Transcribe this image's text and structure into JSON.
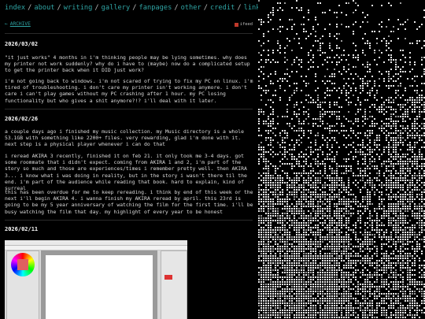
{
  "nav": {
    "items": [
      "index",
      "about",
      "writing",
      "gallery",
      "fanpages",
      "other",
      "credit",
      "links"
    ],
    "separator": "/"
  },
  "archive": {
    "arrow": "←",
    "label": "ARCHIVE"
  },
  "feed": {
    "label": "ifeed"
  },
  "posts": [
    {
      "date": "2026/03/02",
      "paragraphs": [
        "\"it just works\" 4 months in i'm thinking people may be lying sometimes. why does my printer not work suddenly? why do i have to (maybe) now do a complicated setup to get the printer back when it DID just work?",
        "i'm not going back to windows. i'm not scared of trying to fix my PC on linux. i'm tired of troubleshooting. i don't care my printer isn't working anymore. i don't care i can't play games without my PC crashing after 1 hour. my PC losing functionality but who gives a shit anymore?!? i'll deal with it later."
      ]
    },
    {
      "date": "2026/02/26",
      "paragraphs": [
        "a couple days ago i finished my music collection. my Music directory is a whole 53.1GB with something like 2200+ files. very rewarding, glad i'm done with it. next step is a physical player whenever i can do that",
        "i reread AKIRA 3 recently, finished it on feb 21. it only took me 3-4 days. got some roommate that i didn't expect. coming from AKIRA 1 and 2, i'm part of the story so much and those are experiences/times i remember pretty well. then AKIRA 3... i know what i was doing in reality, but in the story i wasn't there til the end. i'm part of the audience while reading that book. hard to explain, kind of surreal",
        "this has been overdue for me to keep rereading. i think by end of this week or the next i'll begin AKIRA 4. i wanna finish my AKIRA reread by april. this 23rd is going to be my 5 year anniversary of watching the film for the first time. i'll be busy watching the film that day. my highlight of every year to be honest"
      ]
    },
    {
      "date": "2026/02/11",
      "paragraphs": []
    }
  ],
  "colors": {
    "link": "#2fa4a4",
    "text": "#dcdcdc",
    "background": "#000000",
    "feed_icon": "#c0392b"
  }
}
